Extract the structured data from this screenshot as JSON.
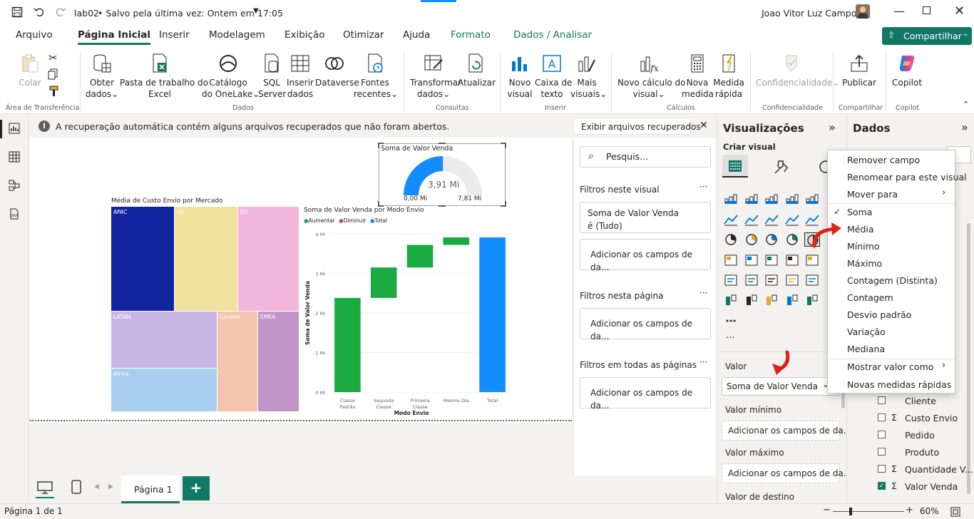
{
  "titlebar": {
    "file_name": "lab02",
    "save_status": "• Salvo pela última vez: Ontem em 17:05",
    "user_name": "Joao Vitor Luz Campos"
  },
  "tabs": [
    "Arquivo",
    "Página Inicial",
    "Inserir",
    "Modelagem",
    "Exibição",
    "Otimizar",
    "Ajuda",
    "Formato",
    "Dados / Analisar"
  ],
  "share_label": "Compartilhar",
  "ribbon": {
    "colar": "Colar",
    "obter_dados": [
      "Obter",
      "dados"
    ],
    "pasta_excel": [
      "Pasta de trabalho do",
      "Excel"
    ],
    "catalogo": [
      "Catálogo",
      "do OneLake"
    ],
    "sql": [
      "SQL",
      "Server"
    ],
    "inserir_dados": [
      "Inserir",
      "dados"
    ],
    "dataverse": "Dataverse",
    "fontes": [
      "Fontes",
      "recentes"
    ],
    "transformar": [
      "Transformar",
      "dados"
    ],
    "atualizar": "Atualizar",
    "novo_visual": [
      "Novo",
      "visual"
    ],
    "caixa_texto": [
      "Caixa de",
      "texto"
    ],
    "mais_visuais": [
      "Mais",
      "visuais"
    ],
    "novo_calculo": [
      "Novo cálculo do",
      "visual"
    ],
    "nova_medida": [
      "Nova",
      "medida"
    ],
    "medida_rapida": [
      "Medida",
      "rápida"
    ],
    "confidencialidade": "Confidencialidade",
    "publicar": "Publicar",
    "copilot": "Copilot",
    "groups": {
      "area": "Área de Transferência",
      "dados": "Dados",
      "consultas": "Consultas",
      "inserir": "Inserir",
      "calculos": "Cálculos",
      "confid": "Confidencialidade",
      "compartilhar": "Compartilhar",
      "copilot": "Copilot"
    }
  },
  "notice": {
    "text": "A recuperação automática contém alguns arquivos recuperados que não foram abertos.",
    "button": "Exibir arquivos recuperados"
  },
  "gauge": {
    "title": "Soma de Valor Venda",
    "value_label": "3,91 Mi",
    "min_label": "0,00 Mi",
    "max_label": "7,81 Mi",
    "value": 3.91,
    "min": 0,
    "max": 7.81
  },
  "treemap": {
    "title": "Média de Custo Envio por Mercado",
    "cells": [
      {
        "label": "APAC",
        "color": "#12239e"
      },
      {
        "label": "US",
        "color": "#efe29d"
      },
      {
        "label": "EU",
        "color": "#f2b6da"
      },
      {
        "label": "LATAM",
        "color": "#c8b7e6"
      },
      {
        "label": "Canada",
        "color": "#f4c5ae"
      },
      {
        "label": "EMEA",
        "color": "#c295c8"
      },
      {
        "label": "Africa",
        "color": "#a7ceef"
      }
    ]
  },
  "chart_data": {
    "type": "waterfall",
    "title": "Soma de Valor Venda por Modo Envio",
    "xlabel": "Modo Envio",
    "ylabel": "Soma de Valor Venda",
    "legend": [
      {
        "name": "Aumentar",
        "color": "#1aab40"
      },
      {
        "name": "Diminuir",
        "color": "#d64554"
      },
      {
        "name": "Total",
        "color": "#118dff"
      }
    ],
    "categories": [
      [
        "Classe",
        "Padrão"
      ],
      [
        "Segunda",
        "Classe"
      ],
      [
        "Primeira",
        "Classe"
      ],
      [
        "Mesmo Dia"
      ],
      [
        "Total"
      ]
    ],
    "values": [
      2.38,
      0.77,
      0.57,
      0.19,
      3.91
    ],
    "kinds": [
      "Aumentar",
      "Aumentar",
      "Aumentar",
      "Aumentar",
      "Total"
    ],
    "y_ticks": [
      "0 Mi",
      "1 Mi",
      "2 Mi",
      "3 Mi",
      "4 Mi"
    ],
    "ylim": [
      0,
      4
    ]
  },
  "filters": {
    "search_placeholder": "Pesquis...",
    "on_visual": "Filtros neste visual",
    "card_line1": "Soma de Valor Venda",
    "card_line2": "é (Tudo)",
    "add_fields": "Adicionar os campos de da...",
    "on_page": "Filtros nesta página",
    "all_pages": "Filtros em todas as páginas"
  },
  "viz": {
    "title": "Visualizações",
    "build": "Criar visual",
    "well_valor": "Valor",
    "well_valor_field": "Soma de Valor Venda",
    "well_min": "Valor mínimo",
    "well_max": "Valor máximo",
    "well_dest": "Valor de destino",
    "add_fields": "Adicionar os campos de da..."
  },
  "dados": {
    "title": "Dados",
    "fields": [
      {
        "name": "Cliente",
        "sigma": false,
        "checked": false
      },
      {
        "name": "Custo Envio",
        "sigma": true,
        "checked": false
      },
      {
        "name": "Pedido",
        "sigma": false,
        "checked": false
      },
      {
        "name": "Produto",
        "sigma": false,
        "checked": false
      },
      {
        "name": "Quantidade V...",
        "sigma": true,
        "checked": false
      },
      {
        "name": "Valor Venda",
        "sigma": true,
        "checked": true
      }
    ]
  },
  "context_menu": {
    "items": [
      "Remover campo",
      "Renomear para este visual",
      "Mover para",
      "Soma",
      "Média",
      "Mínimo",
      "Máximo",
      "Contagem (Distinta)",
      "Contagem",
      "Desvio padrão",
      "Variação",
      "Mediana",
      "Mostrar valor como",
      "Novas medidas rápidas"
    ],
    "checked": "Soma"
  },
  "pages": {
    "tab": "Página 1",
    "add": "+"
  },
  "status": {
    "page": "Página 1 de 1",
    "zoom": "60%"
  },
  "colors": {
    "accent": "#117865",
    "red_arrow": "#e0201a"
  }
}
